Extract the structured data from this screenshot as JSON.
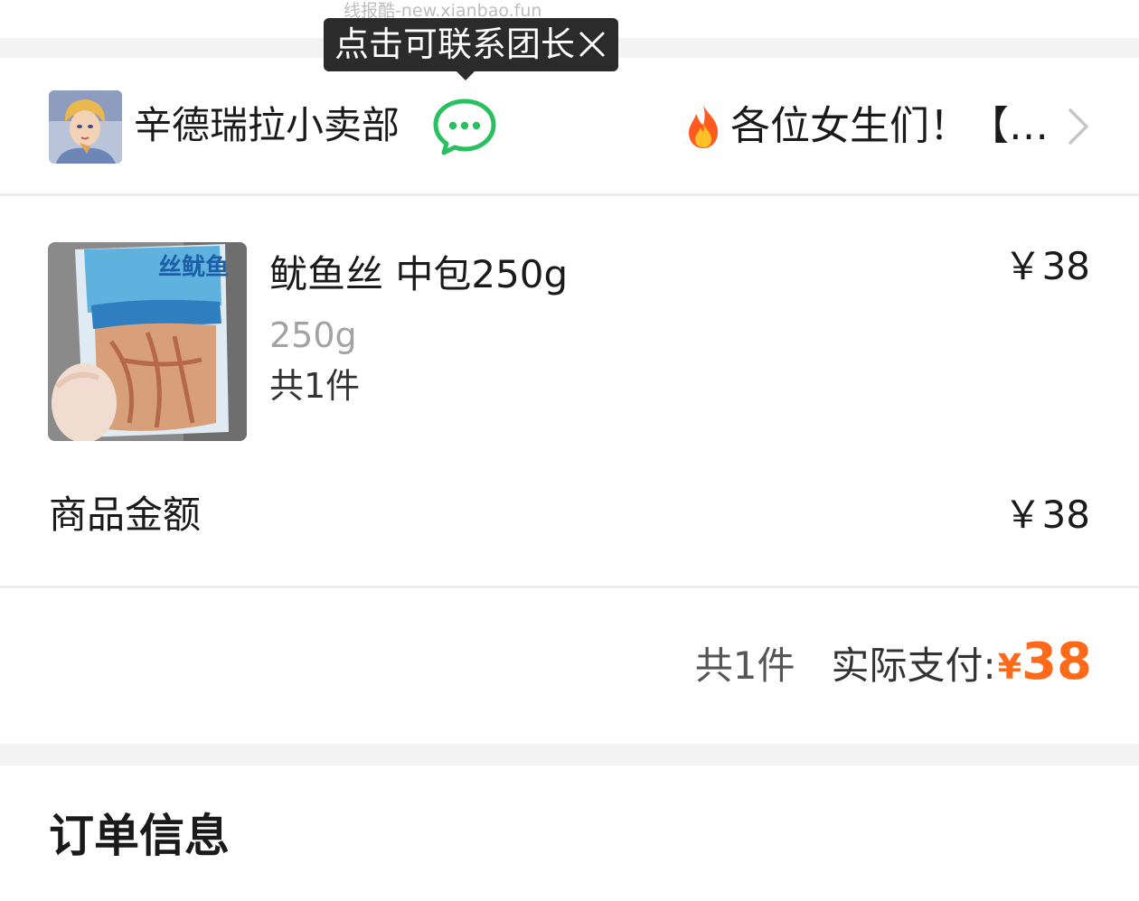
{
  "watermark": "线报酷-new.xianbao.fun",
  "tooltip": {
    "text": "点击可联系团长",
    "close_icon": "close-icon"
  },
  "shop": {
    "name": "辛德瑞拉小卖部",
    "avatar_icon": "avatar",
    "chat_icon": "wechat-chat-icon",
    "announcement": "各位女生们！【…",
    "announcement_icon": "fire-icon",
    "more_icon": "chevron-right-icon"
  },
  "product": {
    "name": "鱿鱼丝 中包250g",
    "spec": "250g",
    "quantity": "共1件",
    "price": "￥38",
    "image_label": "丝鱿鱼"
  },
  "summary": {
    "amount_label": "商品金额",
    "amount_value": "￥38"
  },
  "total": {
    "count": "共1件",
    "label": "实际支付:",
    "currency": "¥",
    "amount": "38"
  },
  "order_info": {
    "title": "订单信息"
  },
  "colors": {
    "accent": "#ff6a1a",
    "wechat_green": "#2ac060",
    "tooltip_bg": "#2b2b2b",
    "band": "#f4f4f4"
  }
}
